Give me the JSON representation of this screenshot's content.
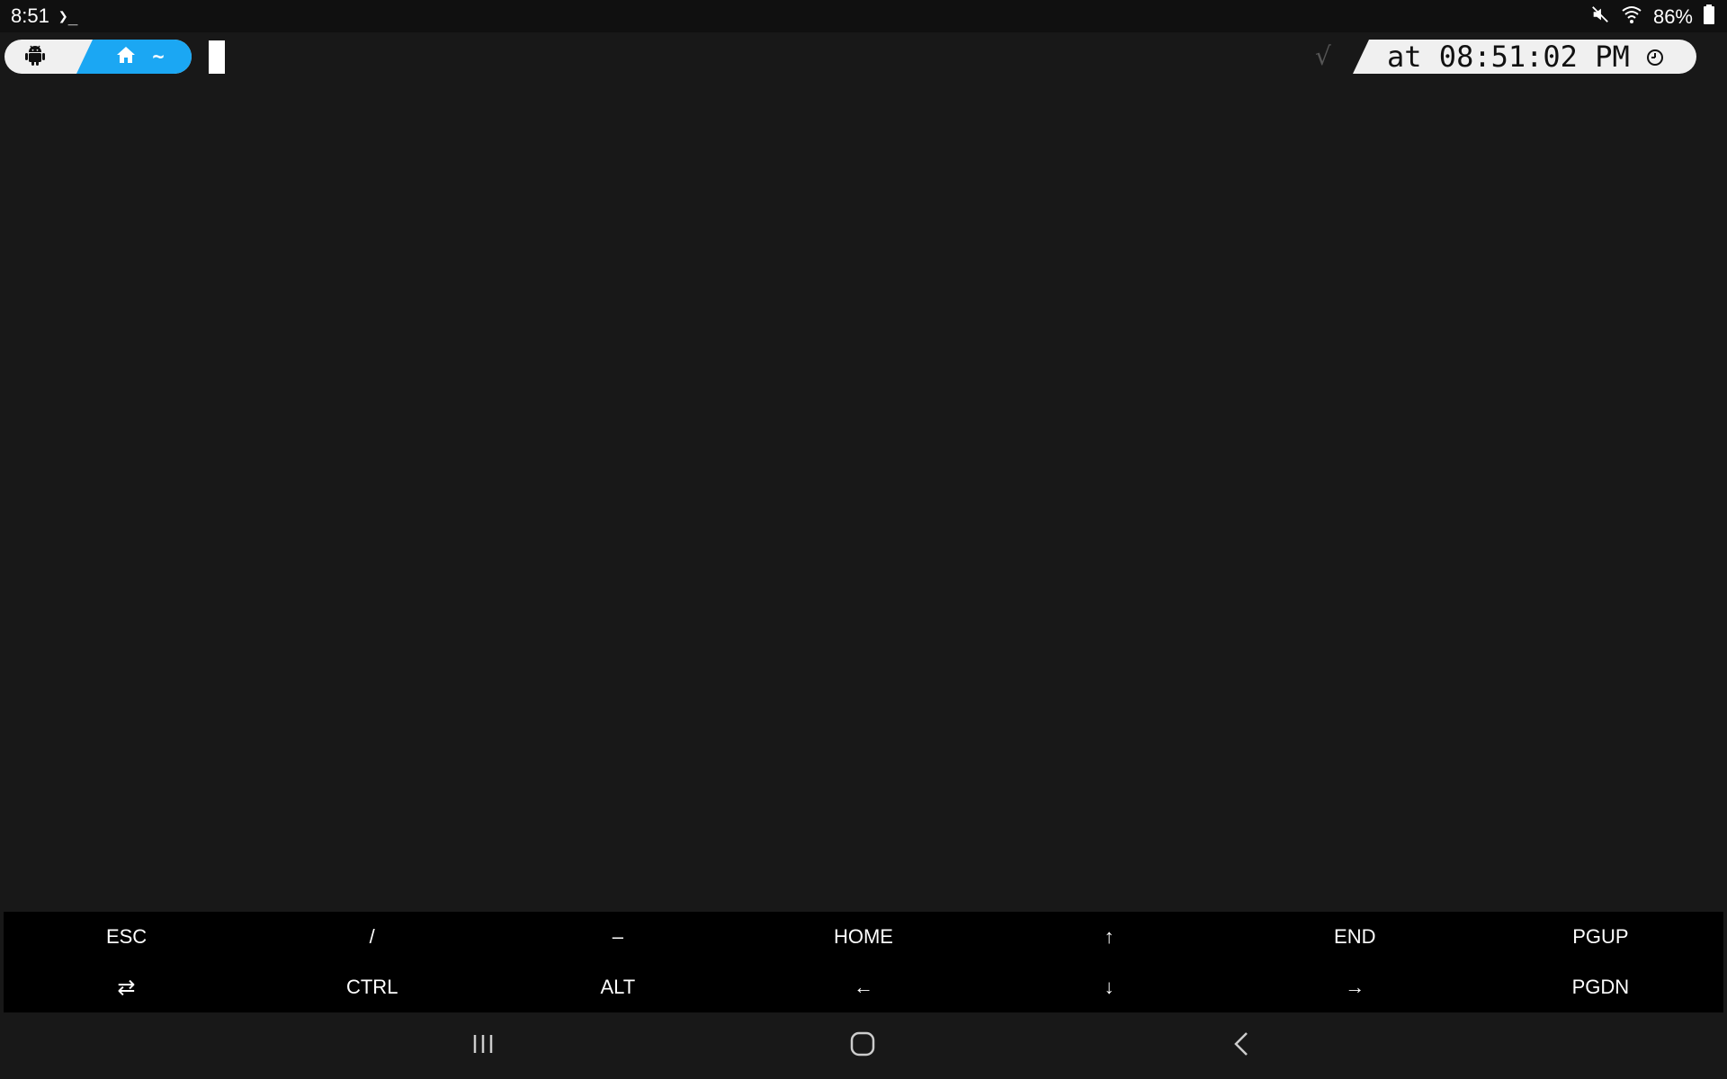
{
  "status_bar": {
    "time": "8:51",
    "terminal_glyph": "❯_",
    "battery_percent": "86%",
    "icons": [
      "mute-icon",
      "wifi-icon",
      "battery-icon"
    ]
  },
  "terminal": {
    "prompt_left": {
      "os_icon": "android-icon",
      "dir_icon": "home-icon",
      "dir_text": "~",
      "accent_color": "#1ba7f3"
    },
    "prompt_right": {
      "status_glyph": "√",
      "time_text": "at 08:51:02 PM",
      "clock_icon": "clock-icon"
    }
  },
  "extra_keys": {
    "row1": [
      "ESC",
      "/",
      "–",
      "HOME",
      "↑",
      "END",
      "PGUP"
    ],
    "row2": [
      "⇄",
      "CTRL",
      "ALT",
      "←",
      "↓",
      "→",
      "PGDN"
    ]
  },
  "nav_bar": {
    "buttons": [
      "recents-icon",
      "home-button-icon",
      "back-icon"
    ]
  }
}
